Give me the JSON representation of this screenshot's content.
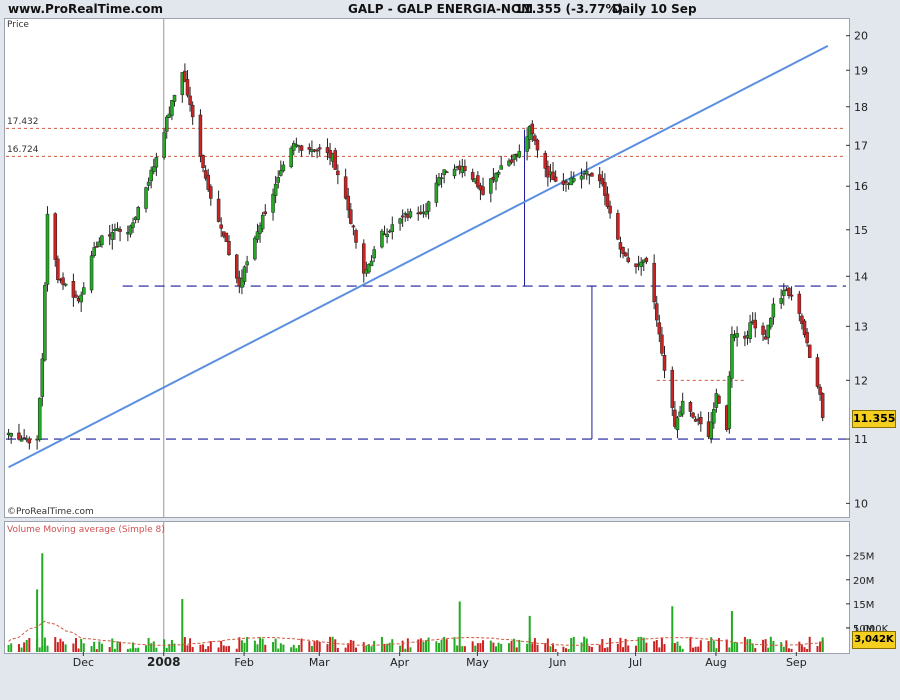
{
  "header": {
    "site": "www.ProRealTime.com",
    "instrument": "GALP - GALP ENERGIA-NOM",
    "quote": "11.355 (-3.77%)",
    "period": "Daily  10 Sep"
  },
  "price_panel": {
    "label": "Price",
    "watermark": "©ProRealTime.com",
    "level_upper": "17.432",
    "level_lower": "16.724",
    "last_price": "11.355"
  },
  "volume_panel": {
    "label": "Volume Moving average (Simple 8)",
    "last_volume": "3,042K"
  },
  "colors": {
    "up": "#22aa22",
    "down": "#cc2222",
    "trendline": "#5b8fe0",
    "support": "#1b1b9a",
    "resistance": "#d05a40"
  },
  "chart_data": [
    {
      "type": "candlestick",
      "title": "GALP - GALP ENERGIA-NOM",
      "ylim": [
        9.8,
        20.5
      ],
      "y_scale": "log",
      "y_ticks": [
        "10",
        "11",
        "12",
        "13",
        "14",
        "15",
        "16",
        "17",
        "18",
        "19",
        "20"
      ],
      "x_ticks": [
        "Dec",
        "2008",
        "Feb",
        "Mar",
        "Apr",
        "May",
        "Jun",
        "Jul",
        "Aug",
        "Sep"
      ],
      "horizontal_levels": [
        17.432,
        16.724,
        13.8,
        11.0,
        12.0
      ],
      "trendline": {
        "from": {
          "date": "2007-11-01",
          "price": 10.55
        },
        "to": {
          "date": "2008-09-12",
          "price": 19.7
        }
      },
      "close_series": [
        {
          "date": "2007-11-01",
          "close": 11.1
        },
        {
          "date": "2007-11-12",
          "close": 10.95
        },
        {
          "date": "2007-11-14",
          "close": 12.4
        },
        {
          "date": "2007-11-16",
          "close": 15.3
        },
        {
          "date": "2007-11-20",
          "close": 14.0
        },
        {
          "date": "2007-11-28",
          "close": 13.5
        },
        {
          "date": "2007-12-05",
          "close": 14.7
        },
        {
          "date": "2007-12-12",
          "close": 15.0
        },
        {
          "date": "2007-12-18",
          "close": 15.0
        },
        {
          "date": "2007-12-27",
          "close": 16.5
        },
        {
          "date": "2008-01-07",
          "close": 19.0
        },
        {
          "date": "2008-01-10",
          "close": 18.0
        },
        {
          "date": "2008-01-16",
          "close": 16.2
        },
        {
          "date": "2008-01-22",
          "close": 15.0
        },
        {
          "date": "2008-01-29",
          "close": 13.8
        },
        {
          "date": "2008-02-05",
          "close": 15.0
        },
        {
          "date": "2008-02-12",
          "close": 16.0
        },
        {
          "date": "2008-02-19",
          "close": 17.0
        },
        {
          "date": "2008-02-28",
          "close": 16.9
        },
        {
          "date": "2008-03-05",
          "close": 16.7
        },
        {
          "date": "2008-03-10",
          "close": 15.7
        },
        {
          "date": "2008-03-17",
          "close": 14.0
        },
        {
          "date": "2008-03-24",
          "close": 14.9
        },
        {
          "date": "2008-04-02",
          "close": 15.3
        },
        {
          "date": "2008-04-10",
          "close": 15.5
        },
        {
          "date": "2008-04-17",
          "close": 16.4
        },
        {
          "date": "2008-04-24",
          "close": 16.5
        },
        {
          "date": "2008-05-02",
          "close": 15.9
        },
        {
          "date": "2008-05-09",
          "close": 16.5
        },
        {
          "date": "2008-05-16",
          "close": 16.8
        },
        {
          "date": "2008-05-20",
          "close": 17.4
        },
        {
          "date": "2008-05-27",
          "close": 16.3
        },
        {
          "date": "2008-06-02",
          "close": 16.1
        },
        {
          "date": "2008-06-10",
          "close": 16.3
        },
        {
          "date": "2008-06-16",
          "close": 16.2
        },
        {
          "date": "2008-06-20",
          "close": 15.3
        },
        {
          "date": "2008-06-25",
          "close": 14.4
        },
        {
          "date": "2008-06-30",
          "close": 14.2
        },
        {
          "date": "2008-07-04",
          "close": 14.3
        },
        {
          "date": "2008-07-07",
          "close": 13.4
        },
        {
          "date": "2008-07-10",
          "close": 12.5
        },
        {
          "date": "2008-07-15",
          "close": 11.2
        },
        {
          "date": "2008-07-18",
          "close": 11.6
        },
        {
          "date": "2008-07-23",
          "close": 11.3
        },
        {
          "date": "2008-07-28",
          "close": 11.1
        },
        {
          "date": "2008-07-31",
          "close": 11.7
        },
        {
          "date": "2008-08-04",
          "close": 11.2
        },
        {
          "date": "2008-08-06",
          "close": 12.9
        },
        {
          "date": "2008-08-11",
          "close": 12.8
        },
        {
          "date": "2008-08-14",
          "close": 13.1
        },
        {
          "date": "2008-08-19",
          "close": 12.8
        },
        {
          "date": "2008-08-22",
          "close": 13.4
        },
        {
          "date": "2008-08-27",
          "close": 13.7
        },
        {
          "date": "2008-09-01",
          "close": 13.3
        },
        {
          "date": "2008-09-05",
          "close": 12.4
        },
        {
          "date": "2008-09-09",
          "close": 11.8
        },
        {
          "date": "2008-09-10",
          "close": 11.355
        }
      ]
    },
    {
      "type": "bar",
      "title": "Volume Moving average (Simple 8)",
      "y_ticks": [
        "5,000K",
        "10M",
        "15M",
        "20M",
        "25M"
      ],
      "ylim": [
        0,
        27000000
      ],
      "highlighted_volumes": [
        {
          "date": "2007-11-12",
          "volume": 13000000
        },
        {
          "date": "2007-11-14",
          "volume": 20500000
        },
        {
          "date": "2008-01-07",
          "volume": 11000000
        },
        {
          "date": "2008-04-23",
          "volume": 10500000
        },
        {
          "date": "2008-05-20",
          "volume": 7500000
        },
        {
          "date": "2008-07-14",
          "volume": 9500000
        },
        {
          "date": "2008-08-06",
          "volume": 8500000
        },
        {
          "date": "2008-09-10",
          "volume": 3042000
        }
      ]
    }
  ]
}
